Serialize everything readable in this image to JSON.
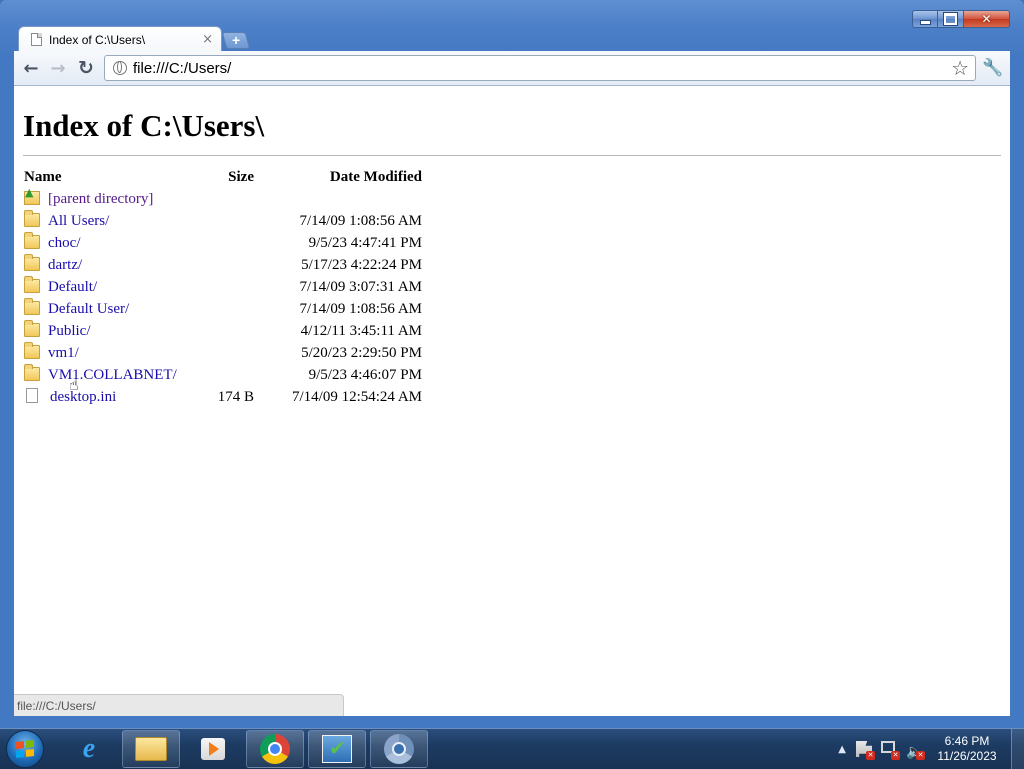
{
  "window": {
    "caption": {
      "close": "✕"
    }
  },
  "tab": {
    "title": "Index of C:\\Users\\",
    "close": "×",
    "new_tab": "+"
  },
  "toolbar": {
    "back": "←",
    "forward": "→",
    "reload": "↻",
    "url": "file:///C:/Users/",
    "star": "☆",
    "wrench": "🔧"
  },
  "page": {
    "title": "Index of C:\\Users\\",
    "columns": {
      "name": "Name",
      "size": "Size",
      "date": "Date Modified"
    },
    "parent": {
      "name": "[parent directory]"
    },
    "entries": [
      {
        "name": "All Users/",
        "size": "",
        "date": "7/14/09 1:08:56 AM",
        "type": "folder"
      },
      {
        "name": "choc/",
        "size": "",
        "date": "9/5/23 4:47:41 PM",
        "type": "folder"
      },
      {
        "name": "dartz/",
        "size": "",
        "date": "5/17/23 4:22:24 PM",
        "type": "folder"
      },
      {
        "name": "Default/",
        "size": "",
        "date": "7/14/09 3:07:31 AM",
        "type": "folder"
      },
      {
        "name": "Default User/",
        "size": "",
        "date": "7/14/09 1:08:56 AM",
        "type": "folder"
      },
      {
        "name": "Public/",
        "size": "",
        "date": "4/12/11 3:45:11 AM",
        "type": "folder"
      },
      {
        "name": "vm1/",
        "size": "",
        "date": "5/20/23 2:29:50 PM",
        "type": "folder"
      },
      {
        "name": "VM1.COLLABNET/",
        "size": "",
        "date": "9/5/23 4:46:07 PM",
        "type": "folder"
      },
      {
        "name": "desktop.ini",
        "size": "174 B",
        "date": "7/14/09 12:54:24 AM",
        "type": "file"
      }
    ]
  },
  "status_bar": {
    "text": "file:///C:/Users/"
  },
  "taskbar": {
    "start_flag_colors": [
      "#f25022",
      "#7fba00",
      "#00a4ef",
      "#ffb900"
    ],
    "tray": {
      "arrow": "▲",
      "volume": "🔈",
      "badge": "✕",
      "time": "6:46 PM",
      "date": "11/26/2023"
    }
  }
}
